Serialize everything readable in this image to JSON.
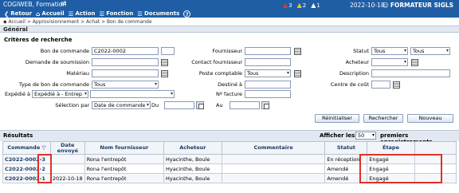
{
  "app": {
    "org": "COGIWEB, Formation",
    "date": "2022-10-18",
    "user": "FORMATEUR SIGLS"
  },
  "nav": [
    {
      "label": "Retour",
      "icon": "back-arrow-icon",
      "glyph": "❮"
    },
    {
      "label": "Accueil",
      "icon": "home-icon",
      "glyph": "⌂"
    },
    {
      "label": "Action",
      "icon": "action-list-icon",
      "glyph": "☰"
    },
    {
      "label": "Fonction",
      "icon": "function-list-icon",
      "glyph": "☰"
    },
    {
      "label": "Documents",
      "icon": "documents-icon",
      "glyph": "☰"
    }
  ],
  "help_glyph": "?",
  "alerts": [
    {
      "count": "3",
      "color": "#e03a2a",
      "icon": "red-alert-icon"
    },
    {
      "count": "2",
      "color": "#f3c624",
      "icon": "yellow-alert-icon"
    },
    {
      "count": "1",
      "color": "#ffffff",
      "icon": "white-alert-icon"
    }
  ],
  "breadcrumb": "◆ Accueil > Approvisionnement > Achat > Bon de commande",
  "section_general": "Général",
  "criteria": {
    "title": "Critères de recherche",
    "bon_commande": {
      "label": "Bon de commande",
      "value": "C2022-0002",
      "value2": ""
    },
    "demande": {
      "label": "Demande de soumission",
      "value": ""
    },
    "materiau": {
      "label": "Matériau",
      "value": ""
    },
    "type_bon": {
      "label": "Type de bon de commande",
      "value": "Tous"
    },
    "expedie": {
      "label": "Expédié à",
      "value": "Expédié à - Entrep",
      "value2": ""
    },
    "selection": {
      "label": "Sélection par",
      "value": "Date de commande",
      "du": "Du",
      "au": "Au"
    },
    "fournisseur": {
      "label": "Fournisseur",
      "value": ""
    },
    "contact": {
      "label": "Contact fournisseur",
      "value": ""
    },
    "poste": {
      "label": "Poste comptable",
      "value": "Tous"
    },
    "destine": {
      "label": "Destiné à",
      "value": ""
    },
    "no_facture": {
      "label": "Nº facture",
      "value": ""
    },
    "statut": {
      "label": "Statut",
      "value1": "Tous",
      "value2": "Tous"
    },
    "acheteur": {
      "label": "Acheteur",
      "value": ""
    },
    "description": {
      "label": "Description",
      "value": ""
    },
    "centre": {
      "label": "Centre de coût",
      "value": ""
    }
  },
  "buttons": {
    "reinit": "Réinitialiser",
    "search": "Rechercher",
    "new": "Nouveau"
  },
  "results": {
    "title": "Résultats",
    "afficher": "Afficher les",
    "per_page": "50",
    "premiers": "premiers enregistrements",
    "columns": [
      "Commande ▽",
      "Date envoyé",
      "Nom fournisseur",
      "Acheteur",
      "Commentaire",
      "Statut",
      "Étape"
    ],
    "rows": [
      {
        "commande": "C2022-0002-3",
        "date": "",
        "fournisseur": "Rona l'entrepôt",
        "acheteur": "Hyacinthe, Boule",
        "commentaire": "",
        "statut": "En réception",
        "etape": "Engagé"
      },
      {
        "commande": "C2022-0002-2",
        "date": "",
        "fournisseur": "Rona l'entrepôt",
        "acheteur": "Hyacinthe, Boule",
        "commentaire": "",
        "statut": "Amendé",
        "etape": "Engagé"
      },
      {
        "commande": "C2022-0002-1",
        "date": "2022-10-18",
        "fournisseur": "Rona l'entrepôt",
        "acheteur": "Hyacinthe, Boule",
        "commentaire": "",
        "statut": "Amendé",
        "etape": "Engagé"
      }
    ]
  }
}
